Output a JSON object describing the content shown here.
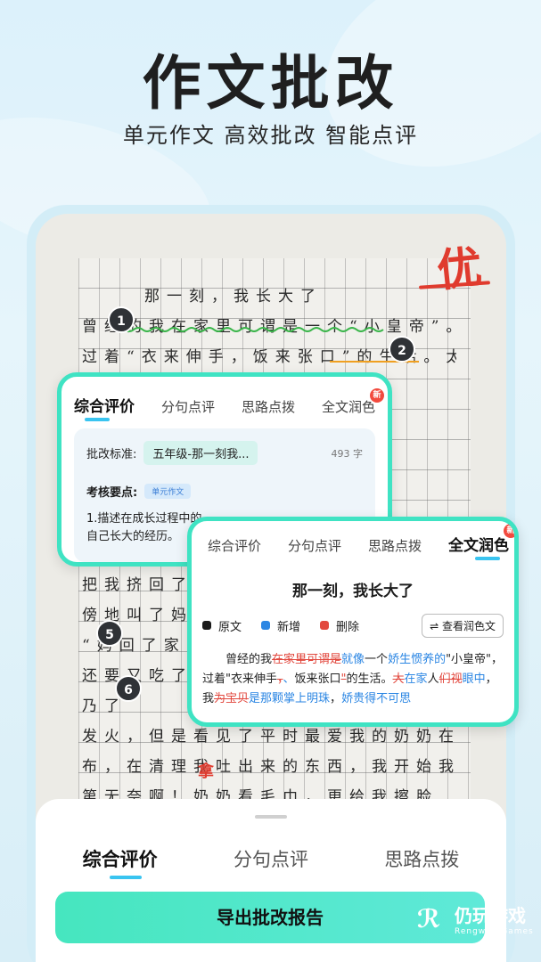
{
  "hero": {
    "title": "作文批改",
    "subtitle": "单元作文 高效批改 智能点评"
  },
  "paper": {
    "grade_mark": "优",
    "rows": [
      "那一刻，我长大了",
      "曾经的我在家里可谓是一个“小皇帝”。",
      "过着“衣来伸手，饭来张口”的生活。太人们",
      "",
      "",
      "",
      "",
      "",
      "",
      "",
      "",
      "",
      "",
      "把我挤回了家",
      "傍地叫了妈妈",
      "“妈回了家",
      "还要又吃了",
      "乃了",
      "发火，但是看见了平时最爱我的奶奶在抹",
      "布，在清理我吐出来的东西，我开始我已",
      "第无奈啊！奶奶看毛巾，更给我擦脸"
    ],
    "markers": [
      "1",
      "2",
      "5",
      "6"
    ],
    "correction_char": "拿"
  },
  "card1": {
    "tabs": [
      {
        "label": "综合评价",
        "active": true
      },
      {
        "label": "分句点评",
        "active": false
      },
      {
        "label": "思路点拨",
        "active": false
      },
      {
        "label": "全文润色",
        "active": false,
        "badge": "新"
      }
    ],
    "standard_label": "批改标准:",
    "standard_value": "五年级-那一刻我...",
    "word_count": "493 字",
    "key_label": "考核要点:",
    "key_chip": "单元作文",
    "requirement": "1.描述在成长过程中的……自己长大的经历。",
    "requirement_line1": "1.描述在成长过程中的",
    "requirement_line2": "自己长大的经历。"
  },
  "card2": {
    "tabs": [
      {
        "label": "综合评价",
        "active": false
      },
      {
        "label": "分句点评",
        "active": false
      },
      {
        "label": "思路点拨",
        "active": false
      },
      {
        "label": "全文润色",
        "active": true,
        "badge": "新"
      }
    ],
    "essay_title": "那一刻，我长大了",
    "legend": [
      {
        "label": "原文",
        "color": "#1a1a1a"
      },
      {
        "label": "新增",
        "color": "#2b86e3"
      },
      {
        "label": "删除",
        "color": "#e2483e"
      }
    ],
    "view_button": "⇌ 查看润色文",
    "essay": {
      "p1": "曾经的我",
      "del1": "在家里可谓是",
      "add1": "就像",
      "p2": "一个",
      "add2": "娇生惯养的",
      "p3": "\"小皇帝\"，过着\"衣来伸手",
      "del2": "，",
      "add3": "、",
      "p4": "饭来张口",
      "del3": "\"",
      "p5": "的生活。",
      "del4": "大",
      "add4": "在家",
      "p6": "人",
      "del5": "们视",
      "add5": "眼中",
      "p7": "，我",
      "del6": "为宝贝",
      "add6": "是那颗掌上明珠",
      "p8": "，",
      "add7": "娇贵得不可思"
    }
  },
  "sheet": {
    "tabs": [
      {
        "label": "综合评价",
        "active": true
      },
      {
        "label": "分句点评",
        "active": false
      },
      {
        "label": "思路点拨",
        "active": false
      }
    ],
    "export_button": "导出批改报告"
  },
  "watermark": {
    "name": "仍玩游戏",
    "sub": "Rengwan Games"
  }
}
